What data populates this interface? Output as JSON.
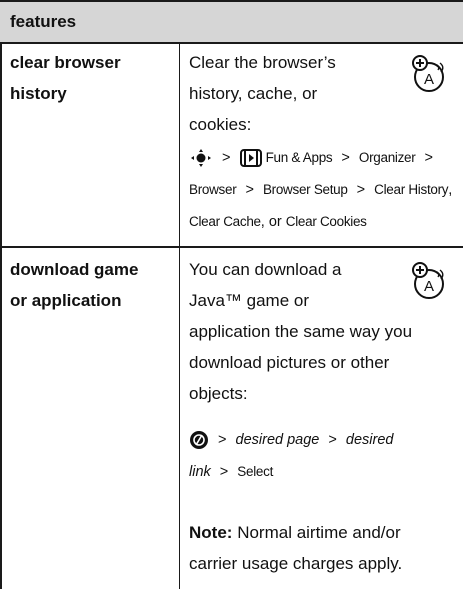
{
  "header": {
    "title": "features"
  },
  "rows": [
    {
      "name_line1": "clear browser",
      "name_line2": "history",
      "desc_lines": [
        "Clear the browser’s",
        "history, cache, or",
        "cookies:"
      ],
      "path": {
        "apps": "Fun & Apps",
        "organizer": "Organizer",
        "browser": "Browser",
        "setup": "Browser Setup",
        "clear_history": "Clear History",
        "comma": ",",
        "clear_cache": "Clear Cache",
        "or": "or",
        "clear_cookies": "Clear Cookies",
        "gt": ">"
      }
    },
    {
      "name_line1": "download game",
      "name_line2": "or application",
      "desc_lines": [
        "You can download a",
        "Java™ game or",
        "application the same way you",
        "download pictures or other",
        "objects:"
      ],
      "path": {
        "desired_page": "desired page",
        "desired": "desired",
        "link": "link",
        "select": "Select",
        "gt": ">"
      },
      "note_label": "Note:",
      "note_text1": "Normal airtime and/or",
      "note_text2": "carrier usage charges apply."
    }
  ]
}
